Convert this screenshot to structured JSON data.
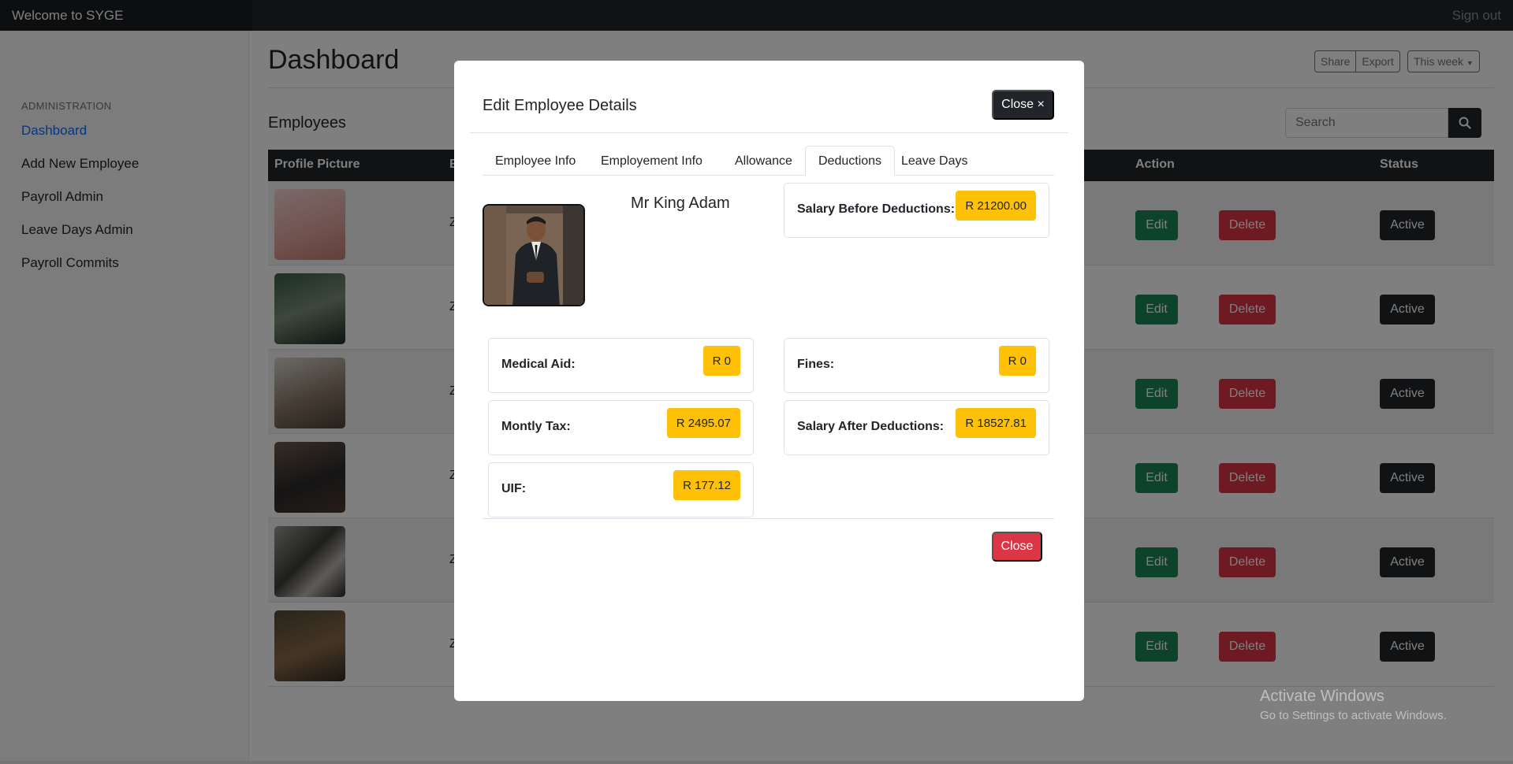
{
  "navbar": {
    "brand": "Welcome to SYGE",
    "signout": "Sign out"
  },
  "sidebar": {
    "heading": "ADMINISTRATION",
    "items": [
      {
        "label": "Dashboard",
        "active": true
      },
      {
        "label": "Add New Employee"
      },
      {
        "label": "Payroll Admin"
      },
      {
        "label": "Leave Days Admin"
      },
      {
        "label": "Payroll Commits"
      }
    ]
  },
  "main": {
    "title": "Dashboard",
    "toolbar": {
      "share": "Share",
      "export": "Export",
      "period": "This week"
    },
    "section_title": "Employees",
    "search": {
      "placeholder": "Search"
    },
    "table": {
      "headers": {
        "profile": "Profile Picture",
        "col2": "E",
        "action": "Action",
        "status": "Status"
      },
      "rows": [
        {
          "cell": "Z",
          "edit": "Edit",
          "delete": "Delete",
          "status": "Active"
        },
        {
          "cell": "Z",
          "edit": "Edit",
          "delete": "Delete",
          "status": "Active"
        },
        {
          "cell": "Z",
          "edit": "Edit",
          "delete": "Delete",
          "status": "Active"
        },
        {
          "cell": "Z",
          "edit": "Edit",
          "delete": "Delete",
          "status": "Active"
        },
        {
          "cell": "Z",
          "edit": "Edit",
          "delete": "Delete",
          "status": "Active"
        },
        {
          "cell": "Z",
          "edit": "Edit",
          "delete": "Delete",
          "status": "Active"
        }
      ]
    }
  },
  "watermark": {
    "line1": "Activate Windows",
    "line2": "Go to Settings to activate Windows."
  },
  "modal": {
    "title": "Edit Employee Details",
    "close_top": "Close ×",
    "tabs": [
      "Employee Info",
      "Employement Info",
      "Allowance",
      "Deductions",
      "Leave Days"
    ],
    "active_tab": "Deductions",
    "employee_name": "Mr King Adam",
    "fields": {
      "salary_before": {
        "label": "Salary Before Deductions:",
        "value": "R 21200.00"
      },
      "medical_aid": {
        "label": "Medical Aid:",
        "value": "R 0"
      },
      "fines": {
        "label": "Fines:",
        "value": "R 0"
      },
      "monthly_tax": {
        "label": "Montly Tax:",
        "value": "R 2495.07"
      },
      "salary_after": {
        "label": "Salary After Deductions:",
        "value": "R 18527.81"
      },
      "uif": {
        "label": "UIF:",
        "value": "R 177.12"
      }
    },
    "close_bottom": "Close"
  },
  "colors": {
    "dark": "#212529",
    "primary": "#0d6efd",
    "success": "#198754",
    "danger": "#dc3545",
    "warning": "#ffc107"
  }
}
